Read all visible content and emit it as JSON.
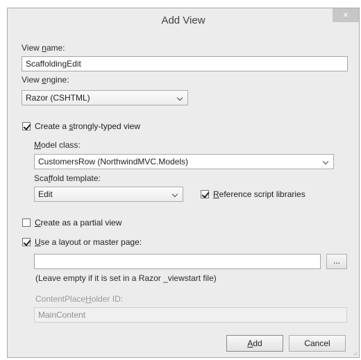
{
  "dialog": {
    "title": "Add View",
    "close": "×"
  },
  "view_name": {
    "label_pre": "View ",
    "label_u": "n",
    "label_post": "ame:",
    "value": "ScaffoldingEdit"
  },
  "view_engine": {
    "label_pre": "View ",
    "label_u": "e",
    "label_post": "ngine:",
    "selected": "Razor (CSHTML)"
  },
  "strongly_typed": {
    "checked": true,
    "text_pre": "Create a ",
    "text_u": "s",
    "text_post": "trongly-typed view"
  },
  "model_class": {
    "label_pre": "",
    "label_u": "M",
    "label_post": "odel class:",
    "selected": "CustomersRow (NorthwindMVC.Models)"
  },
  "scaffold": {
    "label_pre": "Sca",
    "label_u": "f",
    "label_post": "fold template:",
    "selected": "Edit"
  },
  "reference_scripts": {
    "checked": true,
    "text_u": "R",
    "text_post": "eference script libraries"
  },
  "partial_view": {
    "checked": false,
    "text_u": "C",
    "text_post": "reate as a partial view"
  },
  "layout_page": {
    "checked": true,
    "text_u": "U",
    "text_post": "se a layout or master page:",
    "value": "",
    "browse": "...",
    "hint": "(Leave empty if it is set in a Razor _viewstart file)"
  },
  "placeholder": {
    "label_pre": "ContentPlace",
    "label_u": "H",
    "label_post": "older ID:",
    "value": "MainContent"
  },
  "buttons": {
    "add_u": "A",
    "add_post": "dd",
    "cancel": "Cancel"
  }
}
